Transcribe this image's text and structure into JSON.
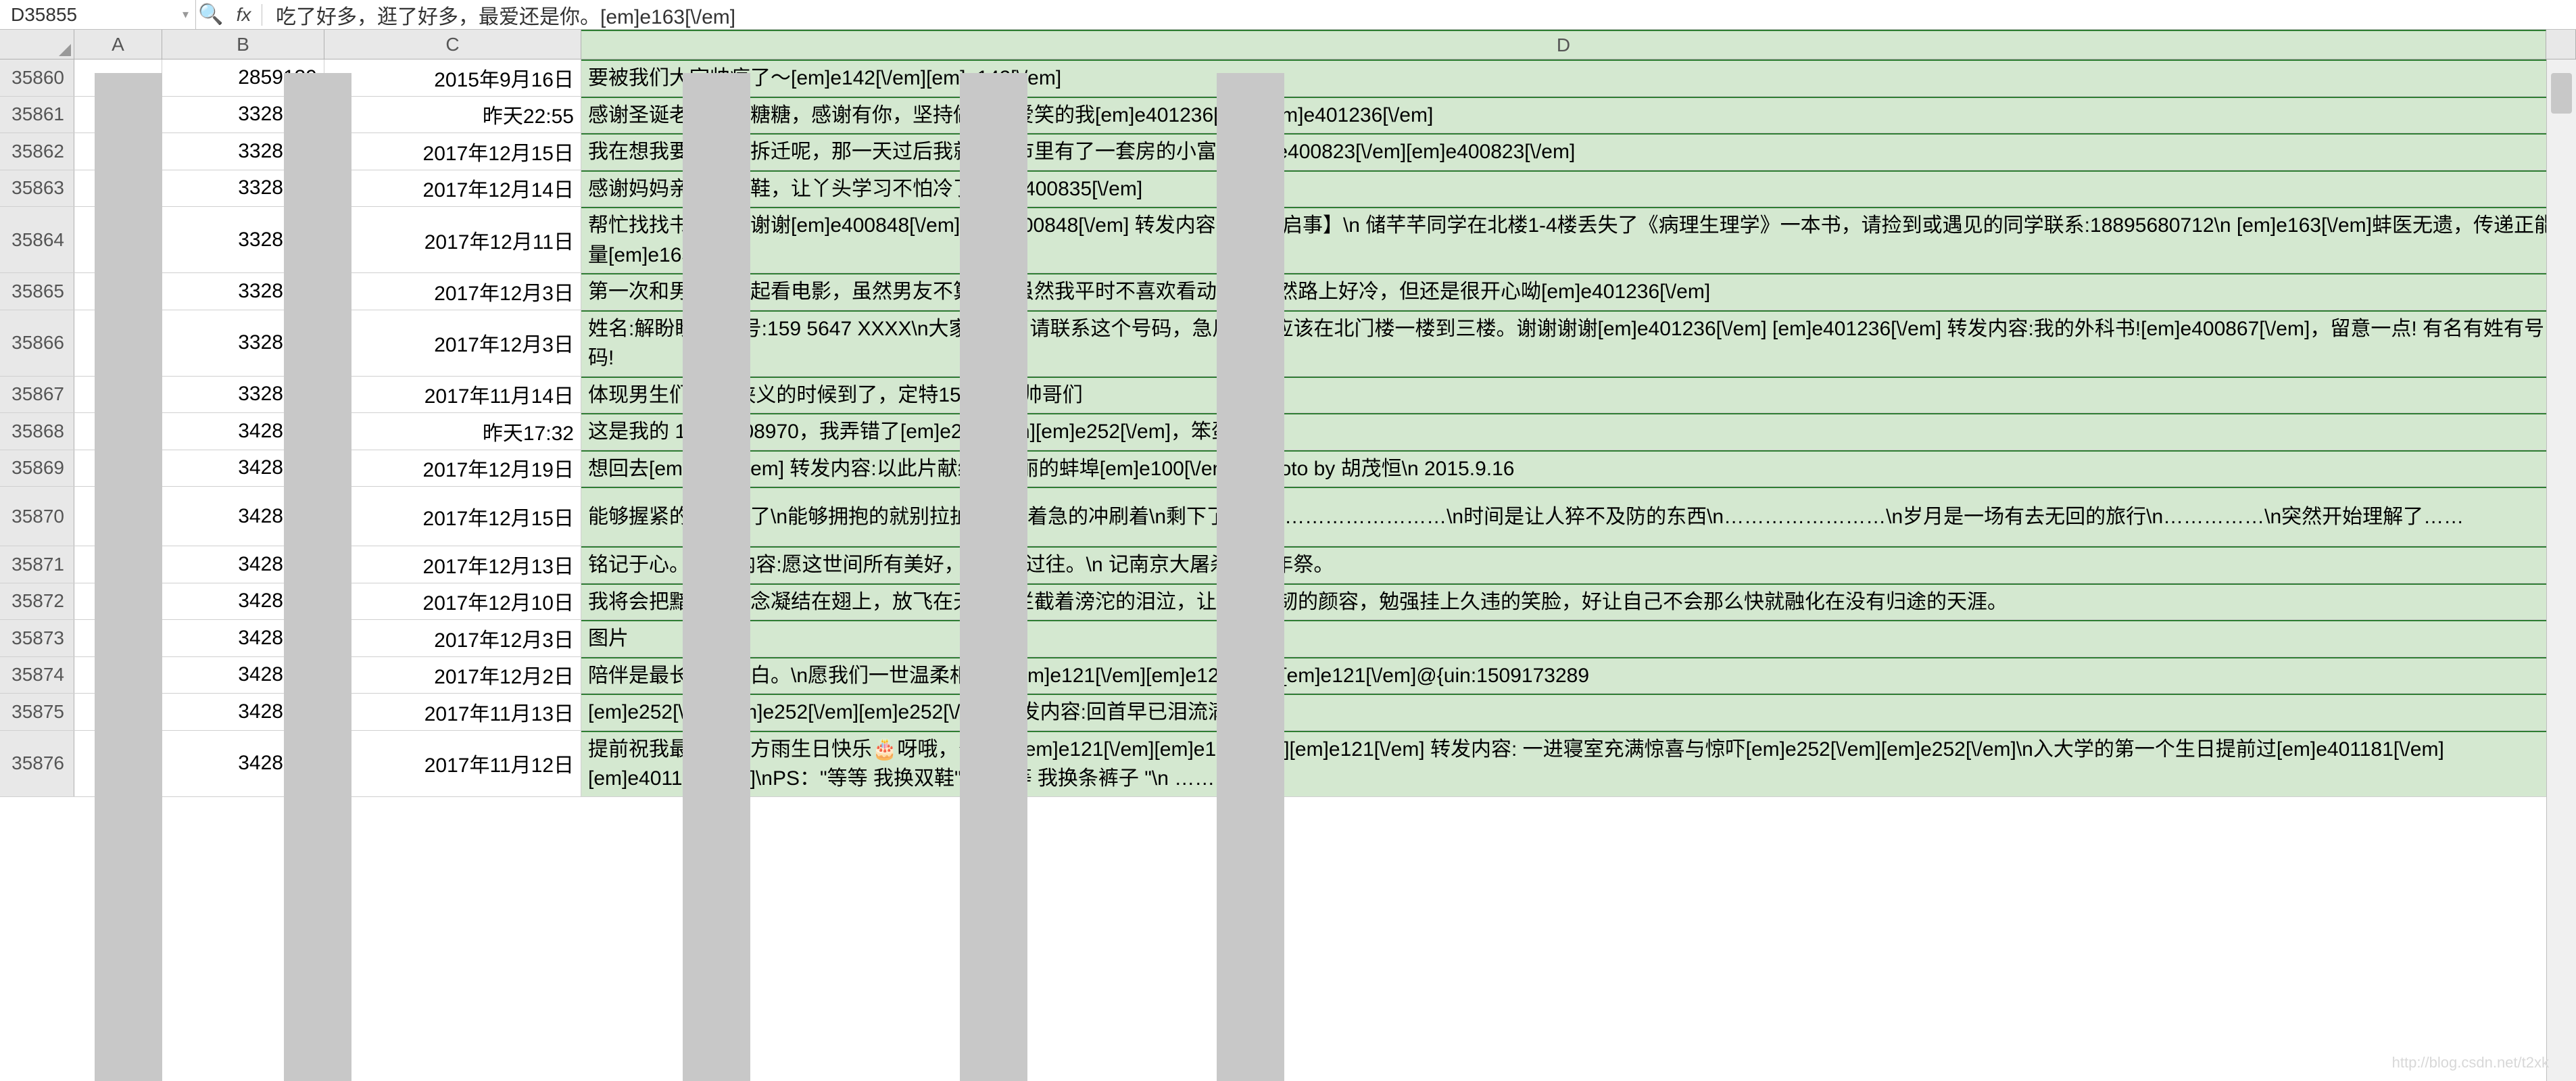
{
  "cell_ref": "D35855",
  "formula": "吃了好多，逛了好多，最爱还是你。[em]e163[\\/em]",
  "columns": {
    "a": "A",
    "b": "B",
    "c": "C",
    "d": "D"
  },
  "rows": [
    {
      "n": "35860",
      "a": "",
      "b": "2859139",
      "c": "2015年9月16日",
      "d": "要被我们大宇帅疯了～[em]e142[\\/em][em]e142[\\/em]",
      "h": 44
    },
    {
      "n": "35861",
      "a": "",
      "b": "3328124",
      "c": "昨天22:55",
      "d": "感谢圣诞老人的大糖糖，感谢有你，坚持做那个爱笑的我[em]e401236[\\/em][em]e401236[\\/em]",
      "h": 44
    },
    {
      "n": "35862",
      "a": "",
      "b": "3328124",
      "c": "2017年12月15日",
      "d": "我在想我要是不会拆迁呢，那一天过后我就是在市里有了一套房的小富婆[em]e400823[\\/em][em]e400823[\\/em]",
      "h": 44
    },
    {
      "n": "35863",
      "a": "",
      "b": "3328124",
      "c": "2017年12月14日",
      "d": "感谢妈妈亲手做的鞋，让丫头学习不怕冷了[em]e400835[\\/em]",
      "h": 44
    },
    {
      "n": "35864",
      "a": "",
      "b": "3328124",
      "c": "2017年12月11日",
      "d": "帮忙找找书，谢谢谢谢[em]e400848[\\/em][em]e400848[\\/em]    转发内容:【寻物启事】\\n 储芊芊同学在北楼1-4楼丢失了《病理生理学》一本书，请捡到或遇见的同学联系:18895680712\\n [em]e163[\\/em]蚌医无遗，传递正能量[em]e163[\\/em]",
      "h": 88
    },
    {
      "n": "35865",
      "a": "",
      "b": "3328124",
      "c": "2017年12月3日",
      "d": "第一次和男朋友一起看电影，虽然男友不算帅，虽然我平时不喜欢看动画，虽然路上好冷，但还是很开心呦[em]e401236[\\/em]",
      "h": 44
    },
    {
      "n": "35866",
      "a": "",
      "b": "3328124",
      "c": "2017年12月3日",
      "d": "姓名:解盼盼   手机号:159 5647 XXXX\\n大家看到了请联系这个号码，急用哦。应该在北门楼一楼到三楼。谢谢谢谢[em]e401236[\\/em] [em]e401236[\\/em]   转发内容:我的外科书![em]e400867[\\/em]，留意一点! 有名有姓有号码!",
      "h": 88
    },
    {
      "n": "35867",
      "a": "",
      "b": "3328124",
      "c": "2017年11月14日",
      "d": "体现男生们   英勇侠义的时候到了，定特15麻醉的帅哥们",
      "h": 37
    },
    {
      "n": "35868",
      "a": "",
      "b": "3428160",
      "c": "昨天17:32",
      "d": "这是我的    18356408970，我弄错了[em]e252[\\/em][em]e252[\\/em]，笨蛋",
      "h": 37
    },
    {
      "n": "35869",
      "a": "",
      "b": "3428160",
      "c": "2017年12月19日",
      "d": "想回去[em]e146[\\/em]   转发内容:以此片献给我美丽的蚌埠[em]e100[\\/em]\\n photo by 胡茂恒\\n 2015.9.16",
      "h": 44
    },
    {
      "n": "35870",
      "a": "",
      "b": "3428160",
      "c": "2017年12月15日",
      "d": "能够握紧的就别放了\\n能够拥抱的就别拉扯\\n时间着急的冲刷着\\n剩下了什么\\n……………………\\n时间是让人猝不及防的东西\\n……………………\\n岁月是一场有去无回的旅行\\n……………\\n突然开始理解了……",
      "h": 88
    },
    {
      "n": "35871",
      "a": "",
      "b": "3428160",
      "c": "2017年12月13日",
      "d": "铭记于心。   转发内容:愿这世间所有美好，都不负过往。\\n           记南京大屠杀80周年祭。",
      "h": 44
    },
    {
      "n": "35872",
      "a": "",
      "b": "3428160",
      "c": "2017年12月10日",
      "d": "我将会把黯然的思念凝结在翅上，放飞在天涯。拦截着滂沱的泪泣，让刻意坚韧的颜容，勉强挂上久违的笑脸，好让自己不会那么快就融化在没有归途的天涯。",
      "h": 44
    },
    {
      "n": "35873",
      "a": "",
      "b": "3428160",
      "c": "2017年12月3日",
      "d": "图片",
      "h": 44
    },
    {
      "n": "35874",
      "a": "",
      "b": "3428160",
      "c": "2017年12月2日",
      "d": "陪伴是最长情的告白。\\n愿我们一世温柔相待。[em]e121[\\/em][em]e121[\\/em][em]e121[\\/em]@{uin:1509173289",
      "h": 44
    },
    {
      "n": "35875",
      "a": "",
      "b": "3428160",
      "c": "2017年11月13日",
      "d": "[em]e252[\\/em][em]e252[\\/em][em]e252[\\/em]   转发内容:回首早已泪流满面，,",
      "h": 44
    },
    {
      "n": "35876",
      "a": "",
      "b": "3428160",
      "c": "2017年11月12日",
      "d": "提前祝我最亲爱的方雨生日快乐🎂呀哦，么么哒[em]e121[\\/em][em]e121[\\/em][em]e121[\\/em]   转发内容: 一进寝室充满惊喜与惊吓[em]e252[\\/em][em]e252[\\/em]\\n入大学的第一个生日提前过[em]e401181[\\/em][em]e401181[\\/em]\\nPS：\"等等 我换双鞋\"\\n   \"等等 我换条裤子 \"\\n ……",
      "h": 88
    }
  ],
  "watermark": "http://blog.csdn.net/t2xk"
}
